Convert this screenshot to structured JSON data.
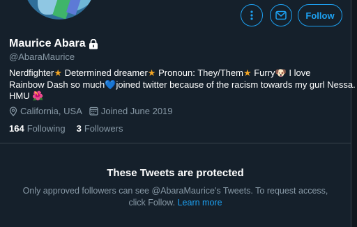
{
  "profile": {
    "name": "Maurice Abara",
    "handle": "@AbaraMaurice",
    "bio_line1_a": "Nerdfighter",
    "bio_line1_b": " Determined dreamer",
    "bio_line1_c": " Pronoun: They/Them",
    "bio_line1_d": " Furry",
    "bio_line1_e": " I love",
    "bio_line2_a": "Rainbow Dash so much",
    "bio_line2_b": "joined twitter because of the racism towards my gurl Nessa.",
    "bio_line3": "HMU",
    "location": "California, USA",
    "joined": "Joined June 2019"
  },
  "emoji": {
    "star": "★",
    "heart": "💙",
    "face": "🐶",
    "flower": "🌺"
  },
  "counts": {
    "following_num": "164",
    "following_label": "Following",
    "followers_num": "3",
    "followers_label": "Followers"
  },
  "actions": {
    "follow_label": "Follow"
  },
  "protected": {
    "title": "These Tweets are protected",
    "body": "Only approved followers can see @AbaraMaurice's Tweets. To request access, click Follow.",
    "link": "Learn more"
  },
  "colors": {
    "accent": "#1da1f2",
    "background": "#15202b",
    "secondary_text": "#8899a6"
  }
}
